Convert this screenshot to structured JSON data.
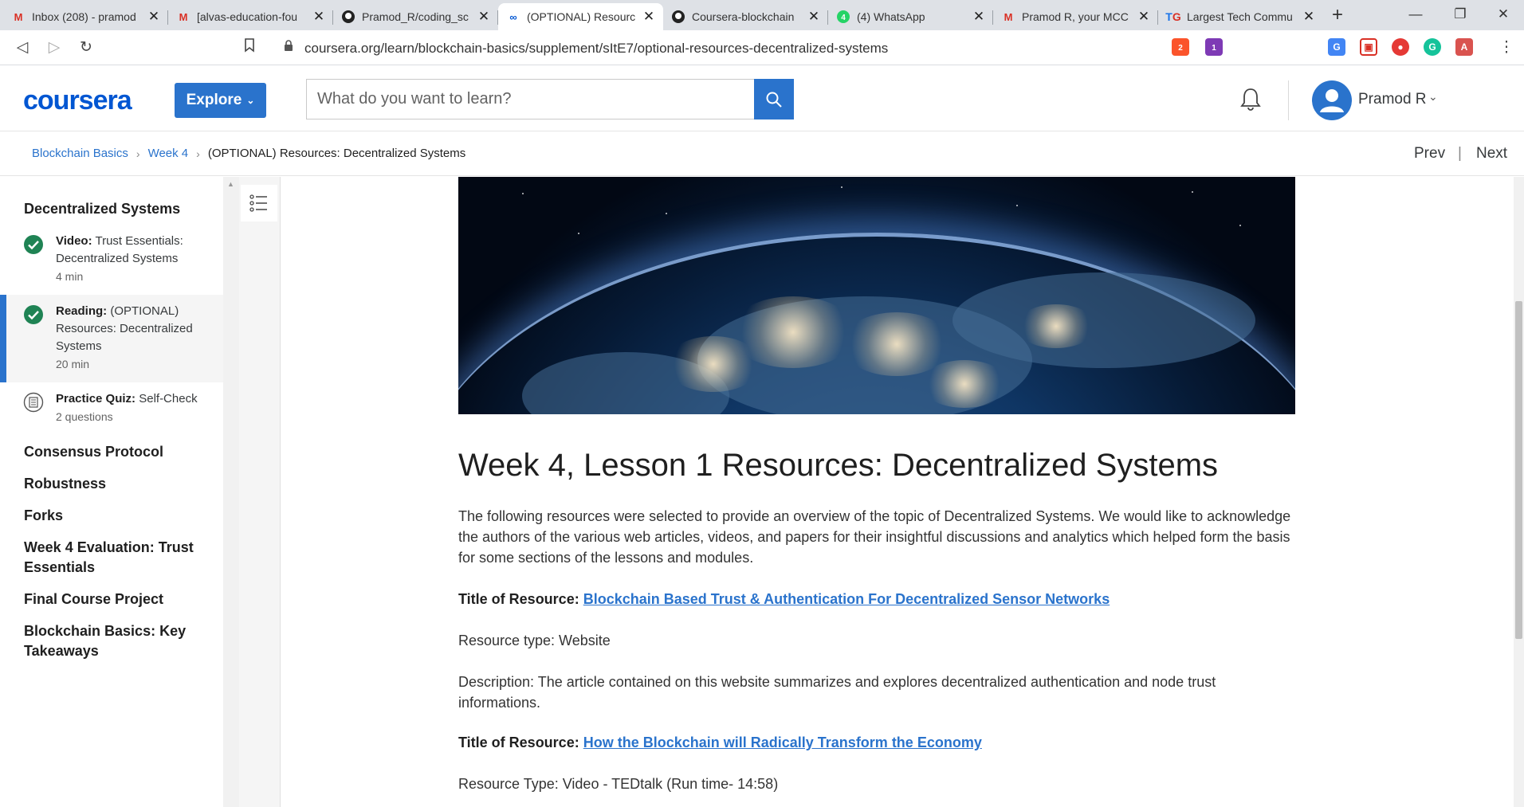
{
  "browser": {
    "tabs": [
      {
        "title": "Inbox (208) - pramod",
        "icon": "gmail-icon"
      },
      {
        "title": "[alvas-education-fou",
        "icon": "gmail-icon"
      },
      {
        "title": "Pramod_R/coding_sc",
        "icon": "github-icon"
      },
      {
        "title": "(OPTIONAL) Resourc",
        "icon": "coursera-icon"
      },
      {
        "title": "Coursera-blockchain",
        "icon": "github-icon"
      },
      {
        "title": "(4) WhatsApp",
        "icon": "whatsapp-icon"
      },
      {
        "title": "Pramod R, your MCC",
        "icon": "gmail-icon"
      },
      {
        "title": "Largest Tech Commu",
        "icon": "tg-icon"
      }
    ],
    "url": "coursera.org/learn/blockchain-basics/supplement/sItE7/optional-resources-decentralized-systems",
    "extension_badges": {
      "brave": "2",
      "alert": "1"
    }
  },
  "header": {
    "logo": "coursera",
    "explore_label": "Explore",
    "search_placeholder": "What do you want to learn?",
    "user_name": "Pramod R"
  },
  "breadcrumb": {
    "course": "Blockchain Basics",
    "week": "Week 4",
    "current": "(OPTIONAL) Resources: Decentralized Systems"
  },
  "nav": {
    "prev": "Prev",
    "next": "Next"
  },
  "sidebar": {
    "current_module": "Decentralized Systems",
    "items": [
      {
        "type_label": "Video:",
        "title": "Trust Essentials: Decentralized Systems",
        "duration": "4 min",
        "status": "completed"
      },
      {
        "type_label": "Reading:",
        "title": "(OPTIONAL) Resources: Decentralized Systems",
        "duration": "20 min",
        "status": "completed"
      },
      {
        "type_label": "Practice Quiz:",
        "title": "Self-Check",
        "duration": "2 questions",
        "status": "not-started"
      }
    ],
    "modules": [
      "Consensus Protocol",
      "Robustness",
      "Forks",
      "Week 4 Evaluation: Trust Essentials",
      "Final Course Project",
      "Blockchain Basics: Key Takeaways"
    ]
  },
  "content": {
    "title": "Week 4, Lesson 1 Resources: Decentralized Systems",
    "intro": "The following resources were selected to provide an overview of the topic of Decentralized Systems. We would like to acknowledge the authors of the various web articles, videos, and papers for their insightful discussions and analytics which helped form the basis for some sections of the lessons and modules.",
    "resource_label": "Title of Resource:",
    "resources": [
      {
        "title": "Blockchain Based Trust & Authentication For Decentralized Sensor Networks",
        "type": "Resource type: Website",
        "description": "Description: The article contained on this website summarizes and explores decentralized authentication and node trust informations."
      },
      {
        "title": "How the Blockchain will Radically Transform the Economy",
        "type": "Resource Type: Video - TEDtalk (Run time- 14:58)"
      }
    ]
  },
  "colors": {
    "brand_blue": "#0056d2",
    "accent_blue": "#2a73cc",
    "complete_green": "#1f8354"
  }
}
